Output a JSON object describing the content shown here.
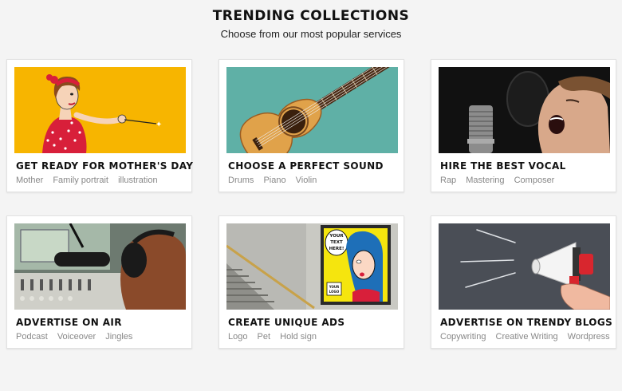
{
  "header": {
    "title": "TRENDING COLLECTIONS",
    "subtitle": "Choose from our most popular services"
  },
  "cards": [
    {
      "title": "GET READY FOR MOTHER'S DAY",
      "tags": [
        "Mother",
        "Family portrait",
        "illustration"
      ],
      "image": "pinup-woman-illustration"
    },
    {
      "title": "CHOOSE A PERFECT SOUND",
      "tags": [
        "Drums",
        "Piano",
        "Violin"
      ],
      "image": "acoustic-guitar"
    },
    {
      "title": "HIRE THE BEST VOCAL",
      "tags": [
        "Rap",
        "Mastering",
        "Composer"
      ],
      "image": "singer-microphone"
    },
    {
      "title": "ADVERTISE ON AIR",
      "tags": [
        "Podcast",
        "Voiceover",
        "Jingles"
      ],
      "image": "radio-studio"
    },
    {
      "title": "CREATE UNIQUE ADS",
      "tags": [
        "Logo",
        "Pet",
        "Hold sign"
      ],
      "image": "billboard-poster"
    },
    {
      "title": "ADVERTISE ON TRENDY BLOGS",
      "tags": [
        "Copywriting",
        "Creative Writing",
        "Wordpress"
      ],
      "image": "megaphone"
    }
  ],
  "posters": {
    "speech_bubble": [
      "YOUR",
      "TEXT",
      "HERE!"
    ],
    "sign": [
      "YOUR",
      "LOGO"
    ]
  },
  "colors": {
    "yellow": "#f7b500",
    "teal": "#5fb0a6",
    "chalkboard": "#4a4e56",
    "megaphone_red": "#d8262e"
  }
}
